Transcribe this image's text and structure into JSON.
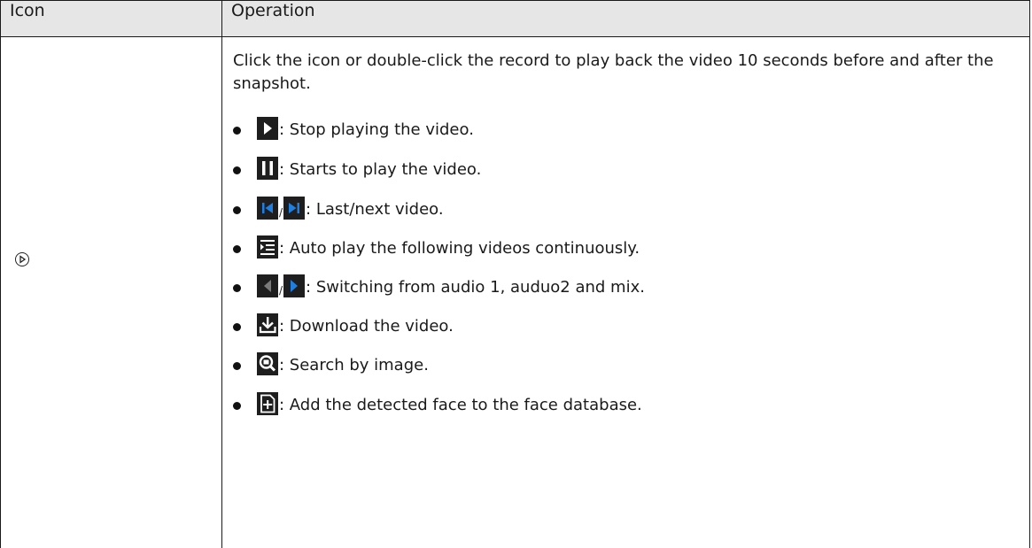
{
  "table": {
    "headers": [
      "Icon",
      "Operation"
    ],
    "row": {
      "icon_name": "play-circle-icon",
      "intro": "Click the icon or double-click the record to play back the video 10 seconds before and after the snapshot.",
      "items": [
        {
          "icons": [
            "play-icon"
          ],
          "text": ": Stop playing the video."
        },
        {
          "icons": [
            "pause-icon"
          ],
          "text": ": Starts to play the video."
        },
        {
          "icons": [
            "previous-video-icon",
            "next-video-icon"
          ],
          "separator": "/",
          "text": ": Last/next video."
        },
        {
          "icons": [
            "auto-play-list-icon"
          ],
          "text": ": Auto play the following videos continuously."
        },
        {
          "icons": [
            "audio-left-icon",
            "audio-right-icon"
          ],
          "separator": "/",
          "text": ": Switching from audio 1, auduo2 and mix."
        },
        {
          "icons": [
            "download-icon"
          ],
          "text": ": Download the video."
        },
        {
          "icons": [
            "search-by-image-icon"
          ],
          "text": ": Search by image."
        },
        {
          "icons": [
            "add-face-icon"
          ],
          "text": ": Add the detected face to the face database."
        }
      ]
    }
  },
  "colors": {
    "header_bg": "#e6e6e6",
    "icon_dark": "#1e1e1e",
    "icon_blue": "#1e7fe0",
    "icon_gray": "#7a7a7a"
  }
}
